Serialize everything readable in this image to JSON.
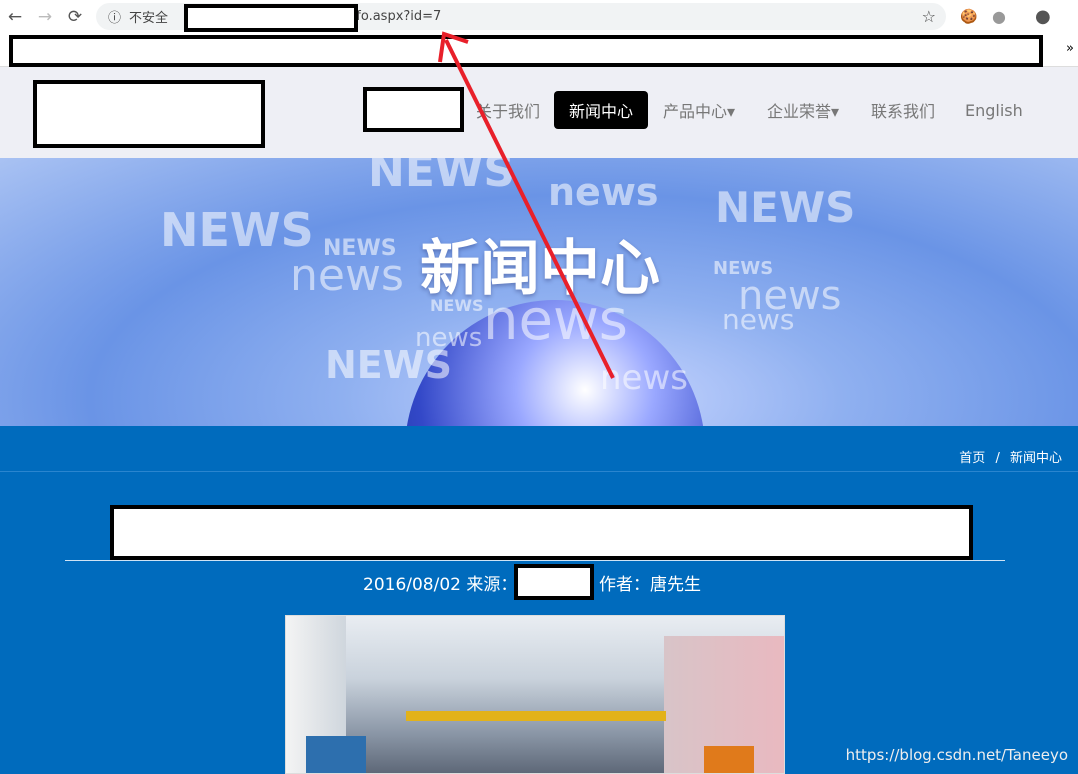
{
  "browser": {
    "back": "←",
    "forward": "→",
    "reload": "⟳",
    "security_label": "不安全",
    "url_visible": "nfo.aspx?id=7",
    "overflow": "»"
  },
  "nav": {
    "items": [
      {
        "label": "关于我们"
      },
      {
        "label": "新闻中心",
        "active": true
      },
      {
        "label": "产品中心▾"
      },
      {
        "label": "企业荣誉▾"
      },
      {
        "label": "联系我们"
      },
      {
        "label": "English"
      }
    ]
  },
  "banner": {
    "title": "新闻中心",
    "words": [
      "NEWS",
      "news",
      "NEWS",
      "NEWS",
      "news",
      "NEWS",
      "news",
      "NEWS",
      "news",
      "news",
      "news",
      "NEWS",
      "news"
    ]
  },
  "breadcrumb": {
    "home": "首页",
    "sep": "/",
    "current": "新闻中心"
  },
  "article": {
    "date": "2016/08/02",
    "source_label": "来源：",
    "author_label": "作者：",
    "author": "唐先生"
  },
  "watermark": "https://blog.csdn.net/Taneeyo",
  "colors": {
    "accent": "#006bbd",
    "nav_active": "#000000",
    "annotation_arrow": "#e8202a"
  }
}
